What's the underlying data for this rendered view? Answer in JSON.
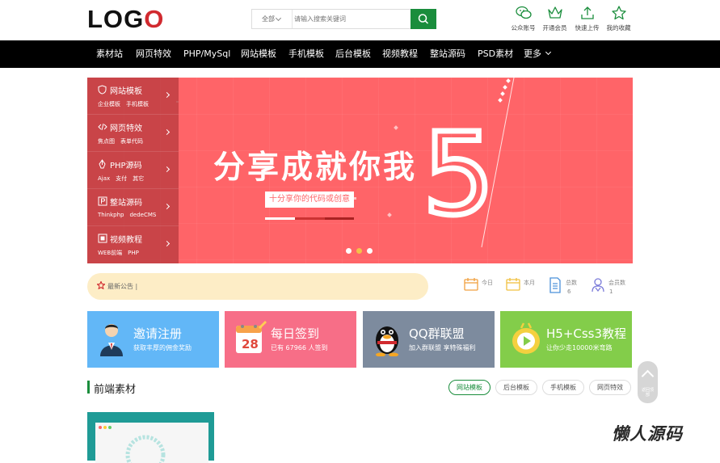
{
  "header": {
    "logo_parts": [
      "LO",
      "G",
      "O"
    ],
    "search": {
      "category": "全部",
      "placeholder": "请输入搜索关键词"
    },
    "user_icons": [
      {
        "label": "公众账号",
        "icon": "wechat-icon"
      },
      {
        "label": "开通会员",
        "icon": "crown-icon"
      },
      {
        "label": "快速上传",
        "icon": "upload-icon"
      },
      {
        "label": "我的收藏",
        "icon": "star-icon"
      }
    ]
  },
  "nav": {
    "items": [
      "素材站",
      "网页特效",
      "PHP/MySql",
      "网站模板",
      "手机模板",
      "后台模板",
      "视频教程",
      "整站源码",
      "PSD素材",
      "更多"
    ]
  },
  "banner": {
    "side_menu": [
      {
        "title": "网站模板",
        "subs": [
          "企业模板",
          "手机模板"
        ],
        "icon": "shield-icon"
      },
      {
        "title": "网页特效",
        "subs": [
          "焦点图",
          "表单代码"
        ],
        "icon": "code-icon"
      },
      {
        "title": "PHP源码",
        "subs": [
          "Ajax",
          "支付",
          "其它"
        ],
        "icon": "pen-icon"
      },
      {
        "title": "整站源码",
        "subs": [
          "Thinkphp",
          "dedeCMS"
        ],
        "icon": "p-icon"
      },
      {
        "title": "视频教程",
        "subs": [
          "WEB前端",
          "PHP"
        ],
        "icon": "video-icon"
      }
    ],
    "title": "分享成就你我",
    "big_number": "5",
    "subtitle": "十分享你的代码或创意",
    "dot_count": 3,
    "active_dot": 1
  },
  "notice": {
    "text": "最新公告 |"
  },
  "stats": [
    {
      "label": "今日",
      "value": "",
      "color": "#f0a040"
    },
    {
      "label": "本月",
      "value": "",
      "color": "#f0c040"
    },
    {
      "label": "总数",
      "value": "6",
      "color": "#4a90d9"
    },
    {
      "label": "会员数",
      "value": "1",
      "color": "#7a7ad9"
    }
  ],
  "cards": [
    {
      "title": "邀请注册",
      "sub": "获取丰厚的佣金奖励",
      "color": "#62b7f7",
      "icon": "person-icon"
    },
    {
      "title": "每日签到",
      "sub": "已有 67966 人签到",
      "color": "#f76e87",
      "icon": "calendar-icon"
    },
    {
      "title": "QQ群联盟",
      "sub": "加入群联盟 享特殊福利",
      "color": "#7d8b9e",
      "icon": "penguin-icon"
    },
    {
      "title": "H5+Css3教程",
      "sub": "让你少走10000米弯路",
      "color": "#83cd4a",
      "icon": "play-icon"
    }
  ],
  "section": {
    "title": "前端素材",
    "tabs": [
      "网站模板",
      "后台模板",
      "手机模板",
      "网页特效"
    ],
    "active_tab": 0
  },
  "float_button": {
    "label": "返回顶部"
  },
  "watermark": "懒人源码",
  "colors": {
    "accent": "#1a8d3c",
    "banner": "#ff6468",
    "logo_red": "#d12a2f"
  }
}
